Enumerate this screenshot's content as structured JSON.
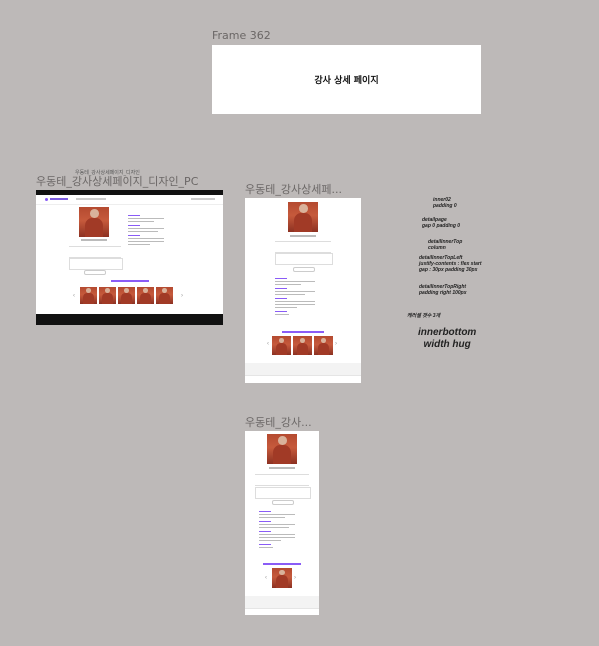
{
  "frames": {
    "frame362": {
      "label": "Frame 362",
      "content": "강사 상세 페이지"
    },
    "pc": {
      "label": "우동테_강사상세페이지_디자인_PC",
      "overlay_label": "우동테_강사상세페이지_디자인"
    },
    "tablet": {
      "label": "우동테_강사상세페..."
    },
    "mobile": {
      "label": "우동테_강사..."
    }
  },
  "notes": [
    {
      "id": "inner02",
      "text": "inner02\npadding 0"
    },
    {
      "id": "detailpage",
      "text": "detailpage\ngap 0 padding 0"
    },
    {
      "id": "detailInnerTop",
      "text": "detailInnerTop\ncolumn"
    },
    {
      "id": "detailInnerTopLeft",
      "text": "detailInnerTopLeft\njustify-contents : flex start\ngap : 30px padding 30px"
    },
    {
      "id": "detailInnerTopRight",
      "text": "detailInnerTopRight\npadding right 100px"
    },
    {
      "id": "card-count",
      "text": "케러셀 갯수 3개"
    },
    {
      "id": "innerbottom",
      "text": "innerbottom\nwidth hug"
    }
  ],
  "colors": {
    "canvas": "#bdb9b8",
    "frame": "#ffffff",
    "accent": "#8a5cf6",
    "photo": "#b44a30"
  }
}
